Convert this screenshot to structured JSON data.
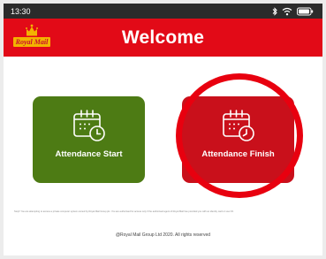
{
  "status_bar": {
    "time": "13:30",
    "icons": [
      "bluetooth-icon",
      "wifi-icon",
      "battery-icon"
    ]
  },
  "header": {
    "logo_text": "Royal Mail",
    "title": "Welcome",
    "brand_color": "#e20a17"
  },
  "tiles": [
    {
      "label": "Attendance Start",
      "icon": "calendar-clock-icon",
      "color": "#4d7b14"
    },
    {
      "label": "Attendance Finish",
      "icon": "calendar-clock-icon",
      "color": "#c9101b"
    }
  ],
  "footer": {
    "disclaimer": "Stop!! You are attempting to access a private computer system owned by Royal Mail Group plc. You are authorised for access only if the authorised agent of Royal Mail has provided you with an identity card or user ID.",
    "copyright": "@Royal Mail Group Ltd 2020. All rights reserved"
  }
}
